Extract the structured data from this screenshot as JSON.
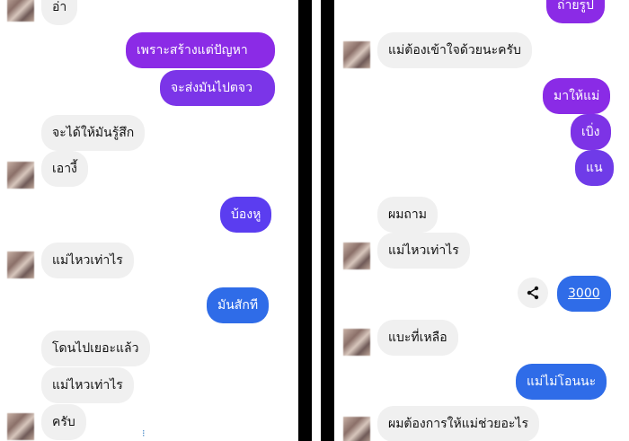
{
  "left": {
    "m1": "อ่า",
    "m2": "เพราะสร้างแต่ปัญหา",
    "m3": "จะส่งมันไปตจว",
    "m4": "จะได้ให้มันรู้สึก",
    "m5": "เอางี้",
    "m6": "บ้องหู",
    "m7": "แม่ไหวเท่าไร",
    "m8": "มันสักที",
    "m9": "โดนไปเยอะแล้ว",
    "m10": "แม่ไหวเท่าไร",
    "m11": "ครับ"
  },
  "right": {
    "m1": "ถ่ายรูป",
    "m2": "แม่ต้องเข้าใจด้วยนะครับ",
    "m3": "มาให้แม่",
    "m4": "เบิ่ง",
    "m5": "แน",
    "m6": "ผมถาม",
    "m7": "แม่ไหวเท่าไร",
    "m8": "3000",
    "m9": "แบะที่เหลือ",
    "m10": "แม่ไม่โอนนะ",
    "m11": "ผมต้องการให้แม่ช่วยอะไร"
  },
  "colors": {
    "outgoing_purple": "#8a2be2",
    "outgoing_blue": "#2f6ce8",
    "incoming": "#f0f0f0",
    "divider": "#000000"
  },
  "icons": [
    "share-icon",
    "blurred-avatar"
  ]
}
